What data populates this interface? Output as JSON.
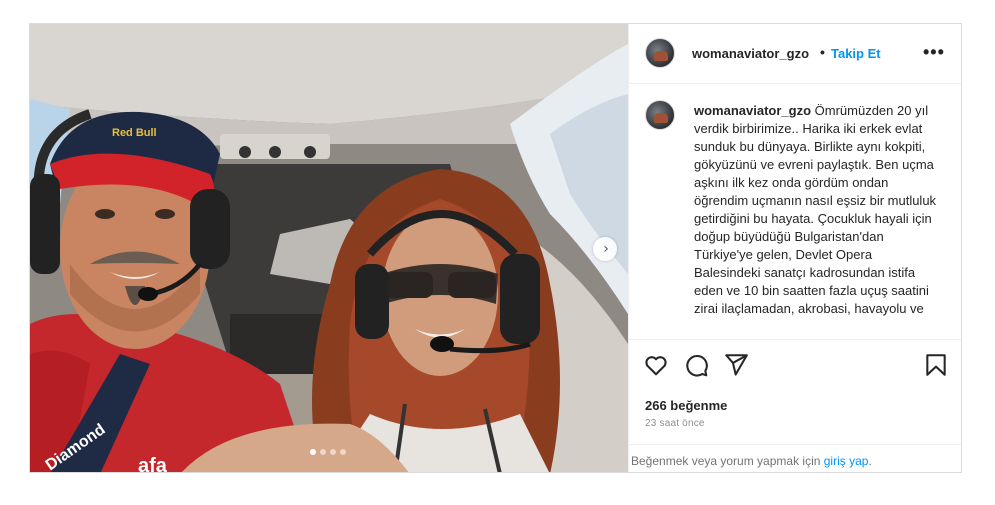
{
  "post": {
    "username": "womanaviator_gzo",
    "separator": "•",
    "follow_label": "Takip Et",
    "more_icon": "•••",
    "caption_username": "womanaviator_gzo",
    "caption_text": " Ömrümüzden 20 yıl verdik birbirimize.. Harika iki erkek evlat sunduk bu dünyaya. Birlikte aynı kokpiti, gökyüzünü ve evreni paylaştık. Ben uçma aşkını ilk kez onda gördüm ondan öğrendim uçmanın nasıl eşsiz bir mutluluk getirdiğini bu hayata. Çocukluk hayali için doğup büyüdüğü Bulgaristan'dan Türkiye'ye gelen, Devlet Opera Balesindeki sanatçı kadrosundan istifa eden ve 10 bin saatten fazla uçuş saatini zirai ilaçlamadan, akrobasi, havayolu ve",
    "likes": "266 beğenme",
    "time": "23 saat önce",
    "comment_prompt": "Beğenmek veya yorum yapmak için ",
    "login_link": "giriş yap",
    "comment_suffix": "."
  },
  "media": {
    "next_icon": "›",
    "carousel_dots": 4,
    "active_dot": 0,
    "cap_logo_text": "Red Bull",
    "shirt_text": "Diamond",
    "sleeve_text": "afa"
  },
  "icons": {
    "like": "heart-icon",
    "comment": "comment-icon",
    "share": "send-icon",
    "save": "bookmark-icon",
    "more": "more-horizontal-icon",
    "next": "chevron-right-icon"
  },
  "colors": {
    "link_blue": "#0095f6",
    "text": "#262626",
    "muted": "#8e8e8e",
    "border": "#dbdbdb"
  }
}
